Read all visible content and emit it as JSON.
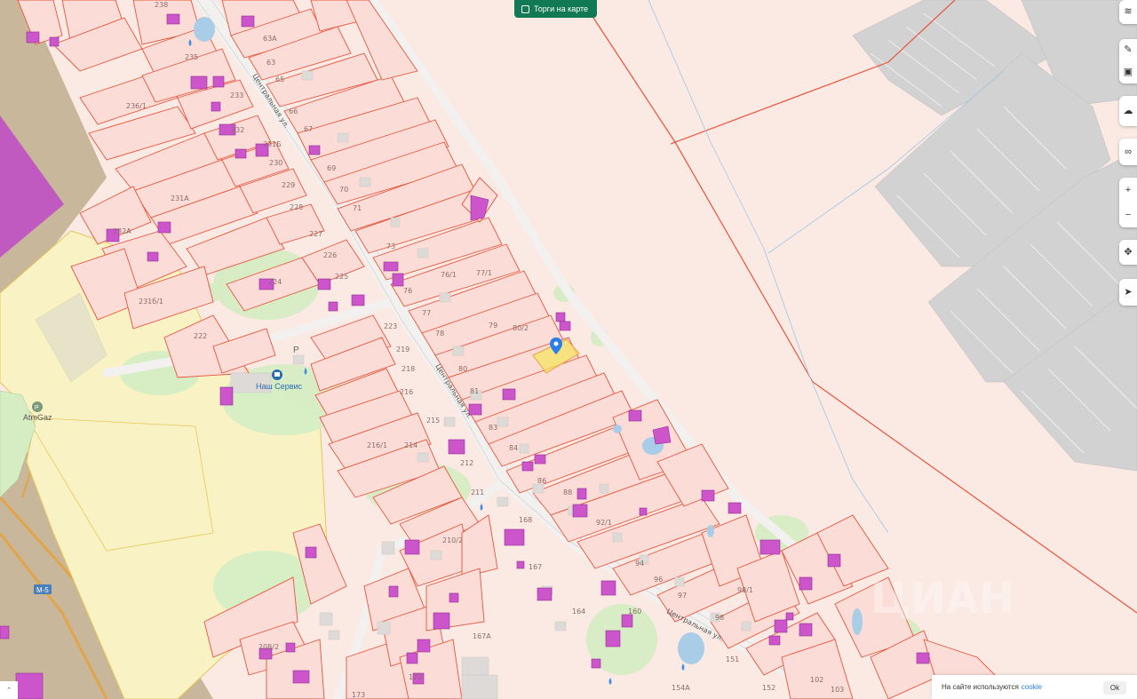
{
  "toolbar": {
    "auction_toggle_label": "Торги на карте"
  },
  "controls": {
    "layers_icon": "layers-icon",
    "draw_icon": "pencil-icon",
    "edit_icon": "edit-icon",
    "cloud_icon": "cloud-icon",
    "link_icon": "link-icon",
    "zoom_in_label": "+",
    "zoom_out_label": "−",
    "fullscreen_icon": "move-icon",
    "locate_icon": "locate-icon"
  },
  "streets": {
    "central_1": "Центральная ул.",
    "central_2": "Центральная ул.",
    "central_3": "Центральная ул.",
    "central_4": "Центральная ул."
  },
  "pois": {
    "nash_service": "Наш Сервис",
    "atm_gaz": "AtmGaz",
    "parking": "P",
    "road_m5": "M-5"
  },
  "lot_labels": [
    "238",
    "63А",
    "235",
    "63",
    "65",
    "233",
    "236/1",
    "66",
    "67",
    "232",
    "231Б",
    "69",
    "230",
    "70",
    "231А",
    "229",
    "71",
    "228",
    "232А",
    "73",
    "227",
    "226",
    "231б/1",
    "225",
    "224",
    "76/1",
    "77/1",
    "76",
    "77",
    "222",
    "223",
    "219",
    "79",
    "78",
    "80/2",
    "218",
    "80",
    "81",
    "216",
    "83",
    "215",
    "216/1",
    "214",
    "84",
    "86",
    "212",
    "88",
    "211",
    "92/1",
    "168",
    "210/2",
    "167",
    "94",
    "96",
    "97",
    "98/1",
    "164",
    "160",
    "98",
    "167А",
    "208/2",
    "151",
    "152",
    "102",
    "103",
    "173",
    "154А",
    "172"
  ],
  "colors": {
    "land_background": "#fbe9e4",
    "parcel_outline": "#e8553c",
    "building": "#cc55cc",
    "green_area": "#d6edc4",
    "yellow_zone": "#f8f2c4",
    "highway_brown": "#c9b79b",
    "selected_parcel": "#f6e25a",
    "marker": "#2b7de9",
    "toggle_green": "#117a54"
  },
  "cookie_banner": {
    "text": "На сайте используются",
    "link": "cookie",
    "ok": "Ok"
  }
}
